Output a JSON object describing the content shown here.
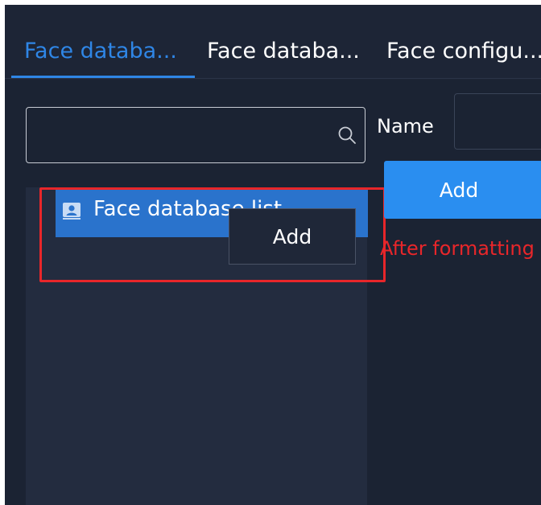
{
  "tabs": [
    {
      "label": "Face databa...",
      "active": true
    },
    {
      "label": "Face databa...",
      "active": false
    },
    {
      "label": "Face configu...",
      "active": false
    }
  ],
  "search": {
    "value": "",
    "icon": "search-icon"
  },
  "tree": {
    "items": [
      {
        "label": "Face database list",
        "icon": "user-card-icon",
        "selected": true
      }
    ]
  },
  "context_menu": {
    "items": [
      {
        "label": "Add"
      }
    ]
  },
  "form": {
    "name_label": "Name",
    "name_value": "",
    "add_label": "Add",
    "error_text": "After formatting"
  },
  "colors": {
    "accent": "#2f86e6",
    "background": "#1b2333",
    "selected": "#2a73cc",
    "error": "#e8262a",
    "button": "#2a8ef0"
  }
}
